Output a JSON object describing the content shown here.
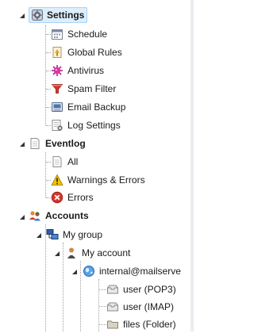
{
  "tree": {
    "settings": {
      "label": "Settings",
      "children": [
        "Schedule",
        "Global Rules",
        "Antivirus",
        "Spam Filter",
        "Email Backup",
        "Log Settings"
      ]
    },
    "eventlog": {
      "label": "Eventlog",
      "children": [
        "All",
        "Warnings & Errors",
        "Errors"
      ]
    },
    "accounts": {
      "label": "Accounts",
      "group": "My group",
      "account": "My account",
      "mailserver": "internal@mailserve",
      "mailboxes": [
        "user (POP3)",
        "user (IMAP)",
        "files (Folder)"
      ]
    }
  },
  "colors": {
    "selection_bg": "#dceefc",
    "selection_border": "#a9d3f5",
    "tree_lines": "#a0a0a0",
    "error_red": "#d9332b",
    "warning_yellow": "#f2c200"
  }
}
